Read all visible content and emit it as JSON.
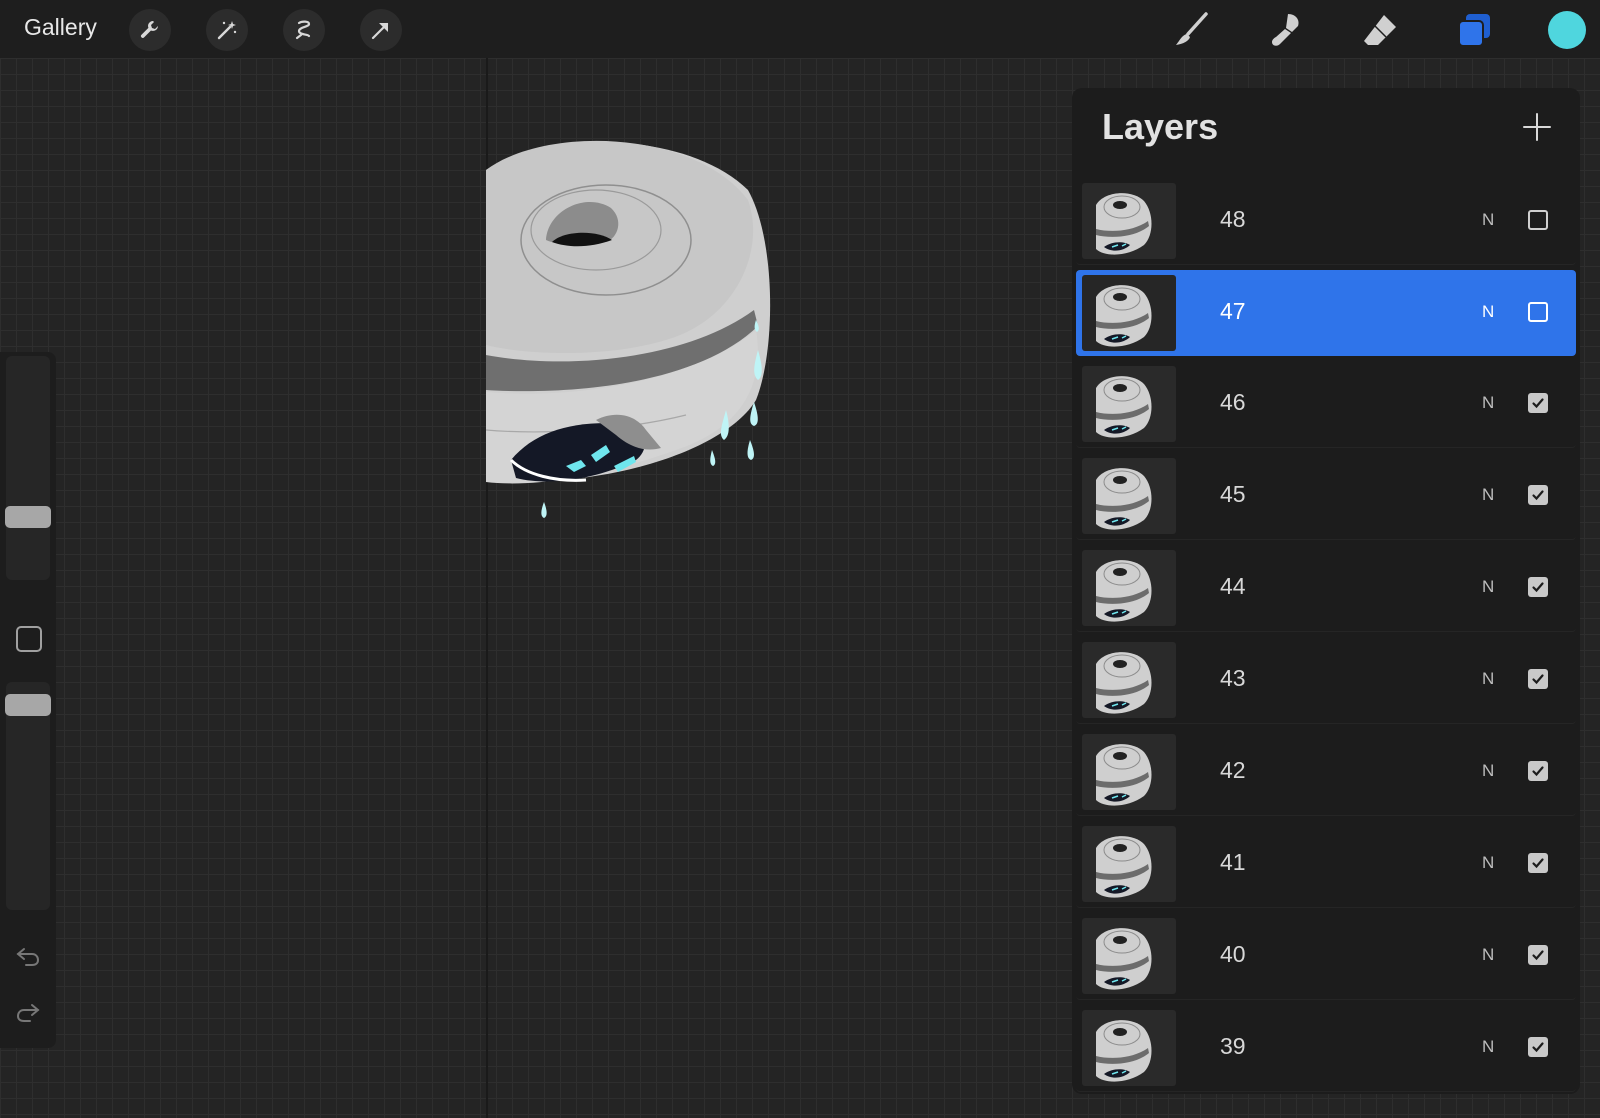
{
  "topbar": {
    "gallery_label": "Gallery",
    "tools_left": [
      "wrench-icon",
      "magic-wand-icon",
      "selection-icon",
      "transform-arrow-icon"
    ],
    "tools_right": [
      "brush-icon",
      "smudge-icon",
      "eraser-icon",
      "layers-icon"
    ],
    "active_color": "#4fd6de"
  },
  "layers": {
    "title": "Layers",
    "selected": "47",
    "items": [
      {
        "name": "48",
        "blend": "N",
        "visible": false
      },
      {
        "name": "47",
        "blend": "N",
        "visible": false
      },
      {
        "name": "46",
        "blend": "N",
        "visible": true
      },
      {
        "name": "45",
        "blend": "N",
        "visible": true
      },
      {
        "name": "44",
        "blend": "N",
        "visible": true
      },
      {
        "name": "43",
        "blend": "N",
        "visible": true
      },
      {
        "name": "42",
        "blend": "N",
        "visible": true
      },
      {
        "name": "41",
        "blend": "N",
        "visible": true
      },
      {
        "name": "40",
        "blend": "N",
        "visible": true
      },
      {
        "name": "39",
        "blend": "N",
        "visible": true
      }
    ]
  },
  "colors": {
    "selection_blue": "#2f74ea",
    "accent_cyan": "#4fd6de"
  }
}
